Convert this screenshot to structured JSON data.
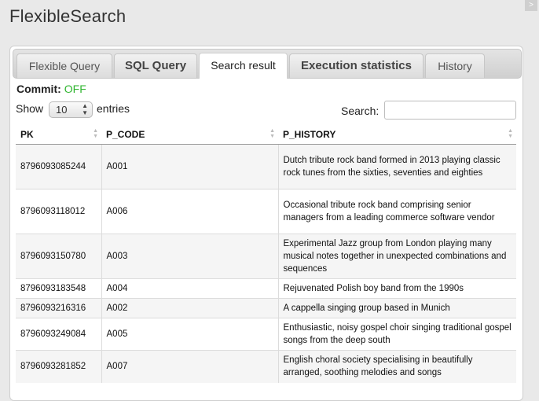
{
  "app": {
    "title": "FlexibleSearch",
    "corner_icon": ">"
  },
  "tabs": [
    {
      "label": "Flexible Query"
    },
    {
      "label": "SQL Query"
    },
    {
      "label": "Search result"
    },
    {
      "label": "Execution statistics"
    },
    {
      "label": "History"
    }
  ],
  "commit": {
    "label": "Commit:",
    "value": "OFF",
    "value_color": "#2fb52f"
  },
  "entries": {
    "show_label": "Show",
    "page_size": "10",
    "suffix": "entries"
  },
  "search": {
    "label": "Search:",
    "value": ""
  },
  "table": {
    "columns": [
      "PK",
      "P_CODE",
      "P_HISTORY"
    ],
    "rows": [
      {
        "pk": "8796093085244",
        "code": "A001",
        "history": "Dutch tribute rock band formed in 2013 playing classic rock tunes from the sixties, seventies and eighties"
      },
      {
        "pk": "8796093118012",
        "code": "A006",
        "history": "Occasional tribute rock band comprising senior managers from a leading commerce software vendor"
      },
      {
        "pk": "8796093150780",
        "code": "A003",
        "history": "Experimental Jazz group from London playing many musical notes together in unexpected combinations and sequences"
      },
      {
        "pk": "8796093183548",
        "code": "A004",
        "history": "Rejuvenated Polish boy band from the 1990s"
      },
      {
        "pk": "8796093216316",
        "code": "A002",
        "history": "A cappella singing group based in Munich"
      },
      {
        "pk": "8796093249084",
        "code": "A005",
        "history": "Enthusiastic, noisy gospel choir singing traditional gospel songs from the deep south"
      },
      {
        "pk": "8796093281852",
        "code": "A007",
        "history": "English choral society specialising in beautifully arranged, soothing melodies and songs"
      }
    ]
  }
}
